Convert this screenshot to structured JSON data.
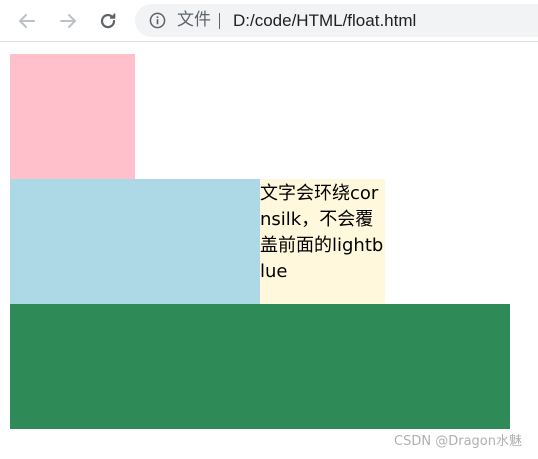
{
  "browser": {
    "back_icon": "arrow-left-icon",
    "forward_icon": "arrow-right-icon",
    "reload_icon": "reload-icon",
    "info_icon": "info-circle-icon",
    "scheme_label": "文件",
    "url": "D:/code/HTML/float.html"
  },
  "page": {
    "float_text": "文字会环绕cornsilk，不会覆盖前面的lightblue",
    "colors": {
      "pink": "#ffc0cb",
      "lightblue": "#add8e6",
      "cornsilk": "#fff8dc",
      "seagreen": "#2e8b57"
    }
  },
  "watermark": "CSDN @Dragon水魅"
}
